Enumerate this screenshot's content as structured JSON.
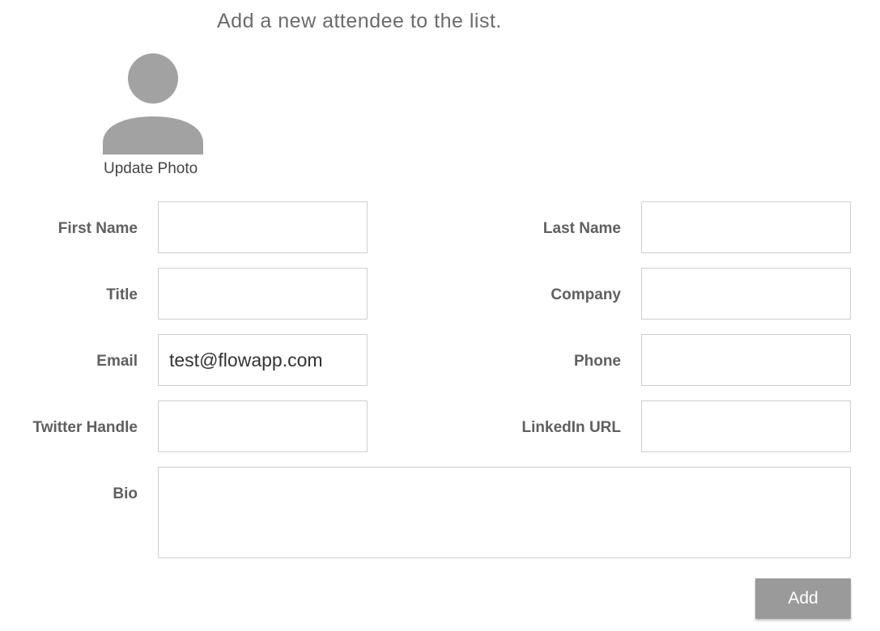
{
  "form": {
    "heading": "Add a new attendee to the list.",
    "update_photo_label": "Update Photo",
    "avatar_icon": "user-silhouette-icon",
    "fields": {
      "first_name": {
        "label": "First Name",
        "value": "",
        "placeholder": ""
      },
      "last_name": {
        "label": "Last Name",
        "value": "",
        "placeholder": ""
      },
      "title": {
        "label": "Title",
        "value": "",
        "placeholder": ""
      },
      "company": {
        "label": "Company",
        "value": "",
        "placeholder": ""
      },
      "email": {
        "label": "Email",
        "value": "test@flowapp.com",
        "placeholder": ""
      },
      "phone": {
        "label": "Phone",
        "value": "",
        "placeholder": ""
      },
      "twitter": {
        "label": "Twitter Handle",
        "value": "",
        "placeholder": ""
      },
      "linkedin": {
        "label": "LinkedIn URL",
        "value": "",
        "placeholder": ""
      },
      "bio": {
        "label": "Bio",
        "value": "",
        "placeholder": ""
      }
    },
    "add_button_label": "Add"
  },
  "colors": {
    "avatar": "#a2a2a2",
    "button_bg": "#9a9a9a",
    "border": "#cfcfcf",
    "label": "#5f5f5f"
  }
}
